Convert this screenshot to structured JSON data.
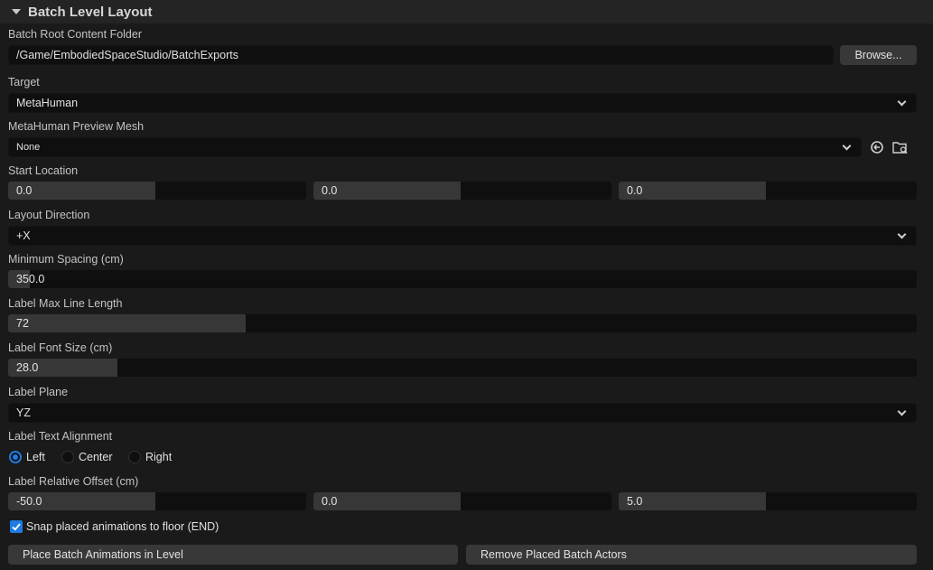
{
  "header": {
    "title": "Batch Level Layout"
  },
  "batch_root": {
    "label": "Batch Root Content Folder",
    "value": "/Game/EmbodiedSpaceStudio/BatchExports",
    "browse_label": "Browse..."
  },
  "target": {
    "label": "Target",
    "value": "MetaHuman"
  },
  "preview_mesh": {
    "label": "MetaHuman Preview Mesh",
    "value": "None"
  },
  "start_location": {
    "label": "Start Location",
    "x": "0.0",
    "y": "0.0",
    "z": "0.0"
  },
  "layout_direction": {
    "label": "Layout Direction",
    "value": "+X"
  },
  "min_spacing": {
    "label": "Minimum Spacing (cm)",
    "value": "350.0"
  },
  "label_max_line": {
    "label": "Label Max Line Length",
    "value": "72"
  },
  "label_font_size": {
    "label": "Label Font Size (cm)",
    "value": "28.0"
  },
  "label_plane": {
    "label": "Label Plane",
    "value": "YZ"
  },
  "label_alignment": {
    "label": "Label Text Alignment",
    "options": [
      "Left",
      "Center",
      "Right"
    ],
    "selected": "Left"
  },
  "label_offset": {
    "label": "Label Relative Offset (cm)",
    "x": "-50.0",
    "y": "0.0",
    "z": "5.0"
  },
  "snap": {
    "label": "Snap placed animations to floor (END)",
    "checked": true
  },
  "actions": {
    "place_label": "Place Batch Animations in Level",
    "remove_label": "Remove Placed Batch Actors"
  },
  "colors": {
    "accent": "#1f7be0",
    "field_bg": "#0f0f0f",
    "panel_bg": "#1a1a1a"
  },
  "icons": {
    "reset": "reset-arrow-icon",
    "browse_asset": "folder-search-icon",
    "dropdown": "chevron-down-icon"
  }
}
